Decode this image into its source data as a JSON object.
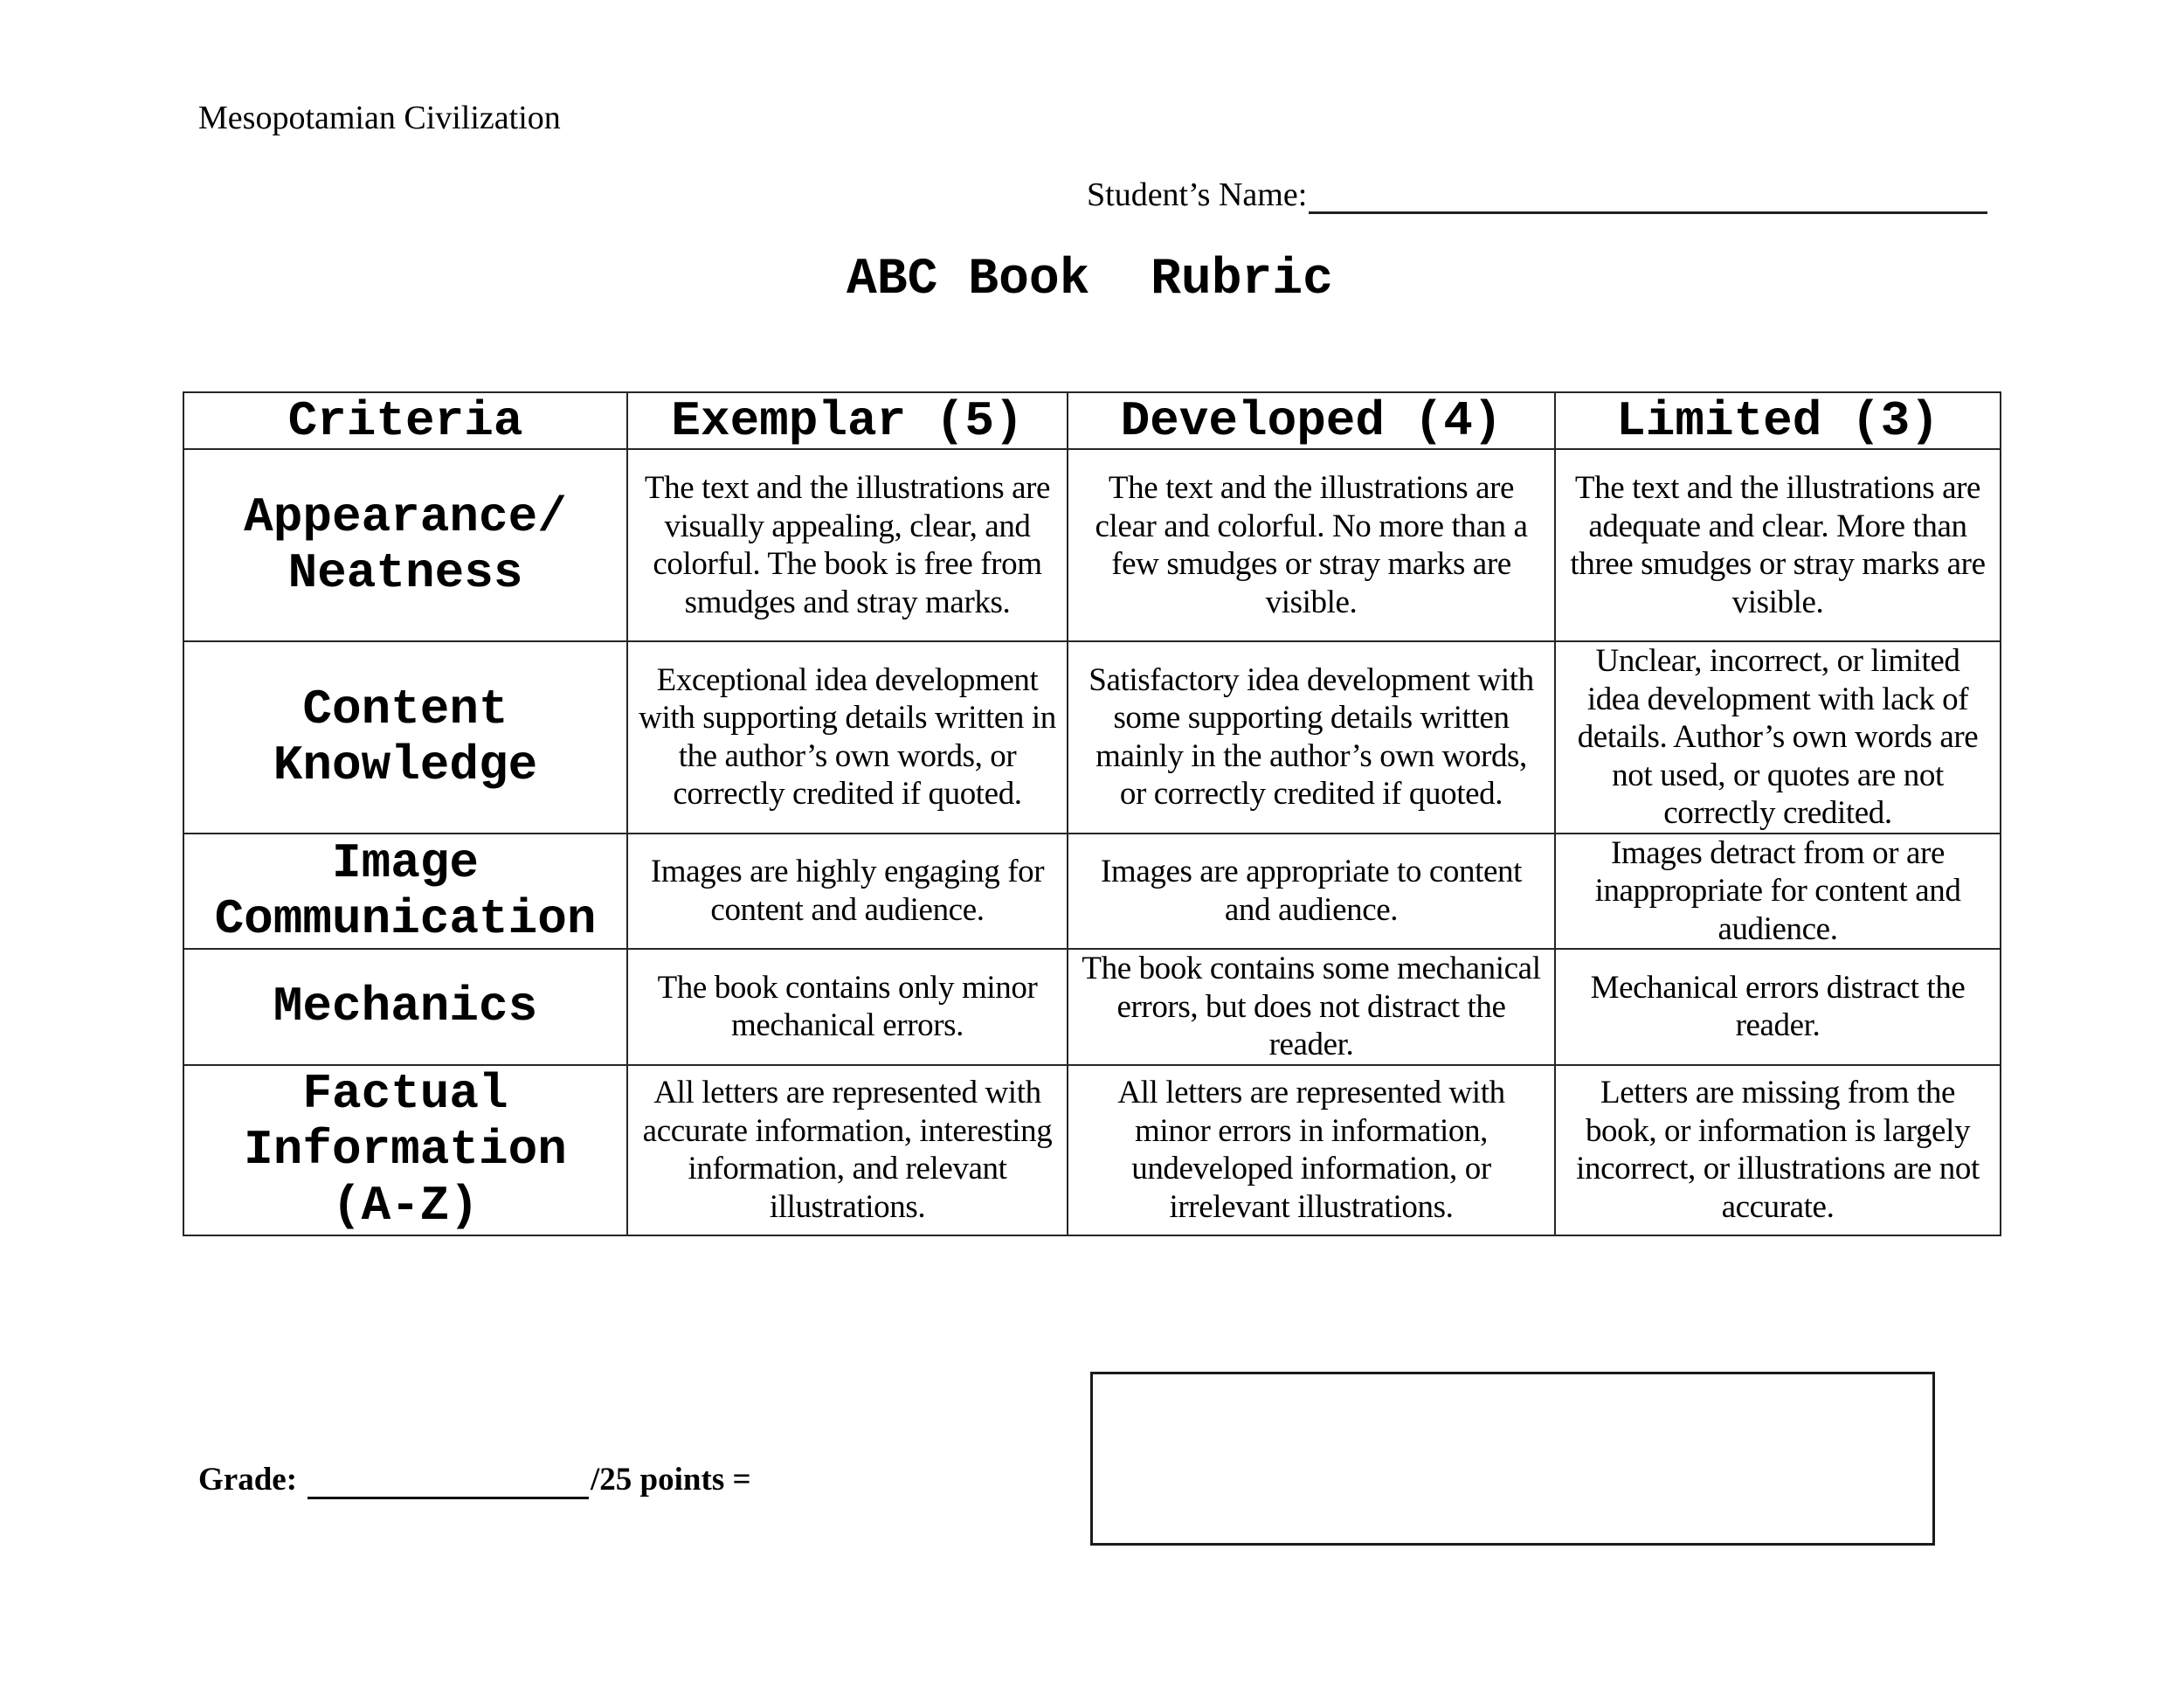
{
  "header": {
    "course": "Mesopotamian Civilization",
    "student_name_label": "Student’s Name:",
    "title": "ABC Book  Rubric"
  },
  "rubric": {
    "columns": [
      "Criteria",
      "Exemplar (5)",
      "Developed (4)",
      "Limited (3)"
    ],
    "rows": [
      {
        "criteria": "Appearance/ Neatness",
        "exemplar": "The text and the illustrations are visually appealing, clear, and colorful.  The book is free from smudges and stray marks.",
        "developed": "The text and the illustrations are clear and colorful.  No more than a few smudges or stray marks are visible.",
        "limited": "The text and the illustrations are adequate and clear.  More than three smudges or stray marks are visible."
      },
      {
        "criteria": "Content Knowledge",
        "exemplar": "Exceptional idea development with supporting details written in the author’s own words, or correctly credited if quoted.",
        "developed": "Satisfactory idea development with some supporting details written mainly in the author’s own words, or correctly credited if quoted.",
        "limited": "Unclear, incorrect, or limited idea development with lack of details.  Author’s own words are not used, or quotes are not correctly credited."
      },
      {
        "criteria": "Image Communication",
        "exemplar": "Images are highly engaging for content and audience.",
        "developed": "Images are appropriate to content and audience.",
        "limited": "Images detract from or are inappropriate for content and audience."
      },
      {
        "criteria": "Mechanics",
        "exemplar": "The book contains only minor mechanical errors.",
        "developed": "The book contains some mechanical errors, but does not distract the reader.",
        "limited": "Mechanical errors distract the reader."
      },
      {
        "criteria": "Factual Information (A-Z)",
        "exemplar": "All letters are represented with accurate information, interesting information, and relevant illustrations.",
        "developed": "All letters are represented with minor errors in information, undeveloped information, or irrelevant illustrations.",
        "limited": "Letters are missing from the book, or information is largely incorrect, or illustrations are not accurate."
      }
    ]
  },
  "footer": {
    "grade_label": "Grade:",
    "points_label": "/25 points ="
  }
}
